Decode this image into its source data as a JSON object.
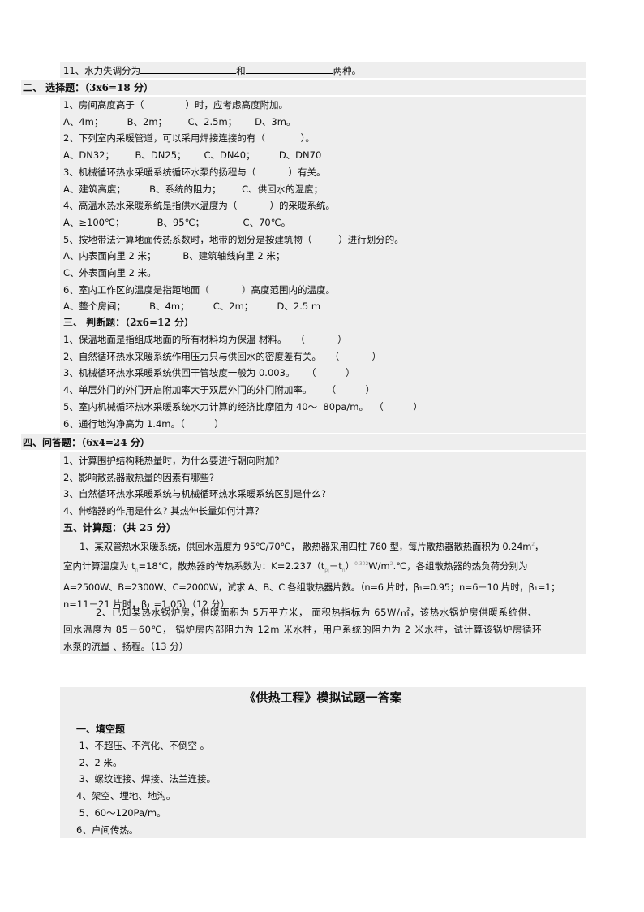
{
  "fill_blank_q11": {
    "prefix": "11、水力失调分为",
    "middle": "和",
    "suffix": "两种。"
  },
  "section2": {
    "heading": "二、 选择题：（3x6=18 分）",
    "lines": [
      "1、房间高度高于（              ）时，应考虑高度附加。",
      "A、4m；        B、2m；       C、2.5m；      D、3m。",
      "2、下列室内采暖管道，可以采用焊接连接的有（            ）。",
      "A、DN32；       B、DN25；      C、DN40；        D、DN70",
      "3、机械循环热水采暖系统循环水泵的扬程与（           ）有关。",
      "A、建筑高度；        B、系统的阻力；       C、供回水的温度；",
      "4、高温水热水采暖系统是指供水温度为（           ）的采暖系统。",
      "A、≥100℃；           B、95℃；             C、70℃。",
      "5、按地带法计算地面传热系数时，地带的划分是按建筑物（         ）进行划分的。",
      "A、内表面向里 2 米；         B、建筑轴线向里 2 米；",
      "C、外表面向里 2 米。",
      "6、室内工作区的温度是指距地面（           ）高度范围内的温度。",
      "A、整个房间；        B、4m；        C、2m；        D、2.5 m"
    ]
  },
  "section3": {
    "heading": "三、  判断题：（2x6=12 分）",
    "lines": [
      "1、保温地面是指组成地面的所有材料均为保温 材料。   （           ）",
      "2、自然循环热水采暖系统作用压力只与供回水的密度差有关。   （           ）",
      "3、机械循环热水采暖系统供回干管坡度一般为 0.003。    （          ）",
      "4、单层外门的外门开启附加率大于双层外门的外门附加率。     （          ）",
      "5、室内机械循环热水采暖系统水力计算的经济比摩阻为 40～  80pa/m。  （          ）",
      "6、通行地沟净高为 1.4m。（          ）"
    ]
  },
  "section4": {
    "heading": "四、问答题：（6x4=24 分）",
    "lines": [
      "1、计算围护结构耗热量时，为什么要进行朝向附加?",
      "2、影响散热器散热量的因素有哪些?",
      "3、自然循环热水采暖系统与机械循环热水采暖系统区别是什么?",
      "4、伸缩器的作用是什么? 其热伸长量如何计算？"
    ]
  },
  "section5": {
    "heading": "五、计算题：（共 25 分）",
    "q1": {
      "l1a": "1、某双管热水采暖系统，供回水温度为 95℃/70℃， 散热器采用四柱 760 型，每片散热器散热面积为 0.24m",
      "l1sup": "2",
      "l1b": "，",
      "l2a": "室内计算温度为 t",
      "l2sub1": "n",
      "l2b": "=18℃，散热器的传热系数为：K=2.237（t",
      "l2sub2": "pj",
      "l2c": "－t",
      "l2sub3": "n",
      "l2d": "）",
      "l2sup": "0.302",
      "l2e": "W/m",
      "l2sup2": "2",
      "l2f": ".℃，各组散热器的热负荷分别为",
      "l3": "A=2500W、B=2300W、C=2000W，试求 A、B、C 各组散热器片数。（n=6 片时，β₁=0.95；n=6－10 片时，β₁=1；",
      "l4": "n=11－21 片时，β₁ =1.05）（12 分）"
    },
    "q2": {
      "l1": "2、已知某热水锅炉房，供暖面积为 5万平方米，  面积热指标为 65W/㎡，该热水锅炉房供暖系统供、",
      "l2": "回水温度为 85－60℃，  锅炉房内部阻力为 12m 米水柱，用户系统的阻力为 2 米水柱，试计算该锅炉房循环",
      "l3": "水泵的流量  、扬程。（13 分）"
    }
  },
  "answers": {
    "title": "《供热工程》模拟试题一答案",
    "heading": "一、填空题",
    "lines": [
      " 1、不超压、不汽化、不倒空 。",
      " 2、2 米。",
      " 3、螺纹连接、焊接、法兰连接。",
      "4、架空、埋地、地沟。",
      " 5、60～120Pa/m。",
      "6、户间传热。"
    ]
  }
}
